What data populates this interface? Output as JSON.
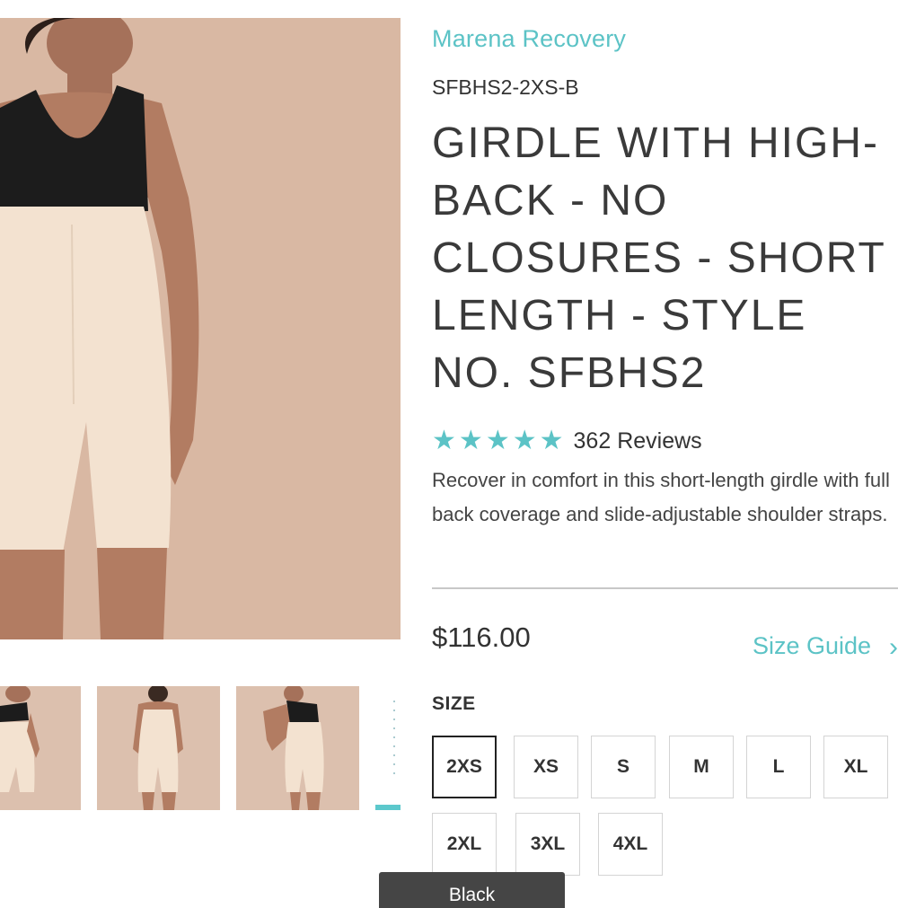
{
  "product": {
    "brand": "Marena Recovery",
    "sku": "SFBHS2-2XS-B",
    "title": "GIRDLE WITH HIGH-BACK - NO CLOSURES - SHORT LENGTH - STYLE NO. SFBHS2",
    "rating": 5,
    "reviews_label": "362 Reviews",
    "description": "Recover in comfort in this short-length girdle with full back coverage and slide-adjustable shoulder straps.",
    "price": "$116.00"
  },
  "size_guide": {
    "label": "Size Guide",
    "icon": "chevron-right-icon"
  },
  "size": {
    "label": "SIZE",
    "selected": "2XS",
    "options": [
      "2XS",
      "XS",
      "S",
      "M",
      "L",
      "XL",
      "2XL",
      "3XL",
      "4XL"
    ]
  },
  "color_toast": {
    "label": "Black"
  },
  "colors": {
    "accent": "#5cc3c6",
    "photo_bg": "#d9b8a3",
    "garment": "#f3e2d0"
  }
}
